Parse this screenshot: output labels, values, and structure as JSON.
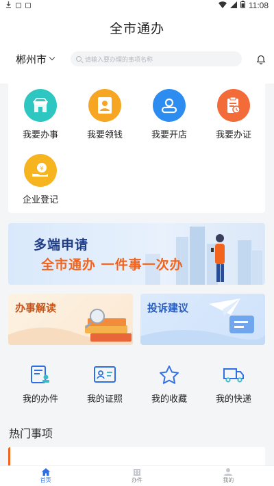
{
  "status_bar": {
    "time": "11:08"
  },
  "header": {
    "title": "全市通办"
  },
  "location": {
    "city": "郴州市"
  },
  "search": {
    "placeholder": "请输入要办理的事项名称"
  },
  "services": [
    {
      "label": "我要办事",
      "icon": "shop-icon",
      "color": "#2ec6c0"
    },
    {
      "label": "我要领钱",
      "icon": "id-portrait-icon",
      "color": "#f6a623"
    },
    {
      "label": "我要开店",
      "icon": "user-icon",
      "color": "#2d8cf0"
    },
    {
      "label": "我要办证",
      "icon": "certificate-icon",
      "color": "#f46b3a"
    },
    {
      "label": "企业登记",
      "icon": "coin-hand-icon",
      "color": "#f6b41e"
    }
  ],
  "banner": {
    "title": "多端申请",
    "subtitle": "全市通办  一件事一次办"
  },
  "cards": {
    "left": {
      "title": "办事解读"
    },
    "right": {
      "title": "投诉建议"
    }
  },
  "quick_links": [
    {
      "label": "我的办件",
      "icon": "document-stamp-icon"
    },
    {
      "label": "我的证照",
      "icon": "id-card-icon"
    },
    {
      "label": "我的收藏",
      "icon": "star-icon"
    },
    {
      "label": "我的快递",
      "icon": "truck-icon"
    }
  ],
  "hot_section": {
    "title": "热门事项"
  },
  "tabbar": [
    {
      "label": "首页",
      "icon": "home-icon",
      "active": true
    },
    {
      "label": "办件",
      "icon": "building-icon",
      "active": false
    },
    {
      "label": "我的",
      "icon": "person-icon",
      "active": false
    }
  ],
  "colors": {
    "accent": "#2f6fe3",
    "orange": "#f2641e",
    "navy": "#1f3c86"
  }
}
